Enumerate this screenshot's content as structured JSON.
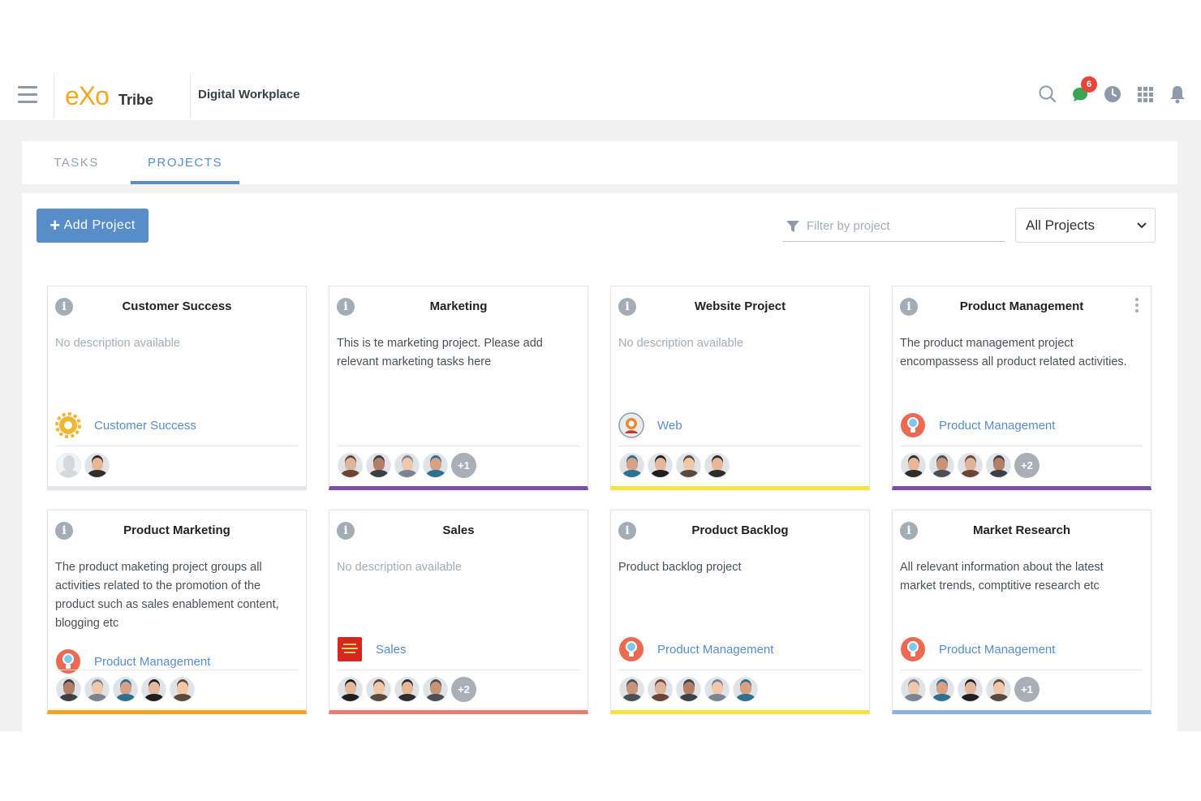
{
  "header": {
    "logo_text": "eXo",
    "brand_suffix": "Tribe",
    "workspace": "Digital Workplace",
    "chat_badge": "6"
  },
  "tabs": {
    "tasks": "TASKS",
    "projects": "PROJECTS",
    "active": "projects"
  },
  "toolbar": {
    "add_label": "Add Project",
    "filter_placeholder": "Filter by project",
    "select_value": "All Projects"
  },
  "colors": {
    "accent": "#578dc9",
    "logo": "#f4a81d",
    "badge": "#e9453a"
  },
  "projects": [
    {
      "title": "Customer Success",
      "description": "No description available",
      "space": "Customer Success",
      "space_icon": "gear-icon",
      "members_more": "",
      "color": "#e3e5e8"
    },
    {
      "title": "Marketing",
      "description": "This is te marketing project. Please add relevant marketing tasks here",
      "space": "",
      "space_icon": "",
      "members_more": "+1",
      "color": "#7e4fad"
    },
    {
      "title": "Website Project",
      "description": "No description available",
      "space": "Web",
      "space_icon": "web-space-icon",
      "members_more": "",
      "color": "#f6e33c"
    },
    {
      "title": "Product Management",
      "description": "The product management project encompassess all product related activities.",
      "space": "Product Management",
      "space_icon": "lightbulb-icon",
      "members_more": "+2",
      "color": "#7e4fad"
    },
    {
      "title": "Product Marketing",
      "description": "The product maketing project groups all activities related to the promotion of the product such as sales enablement content, blogging etc",
      "space": "Product Management",
      "space_icon": "lightbulb-icon",
      "members_more": "",
      "color": "#f2a41c"
    },
    {
      "title": "Sales",
      "description": "No description available",
      "space": "Sales",
      "space_icon": "sales-space-icon",
      "members_more": "+2",
      "color": "#ea7d73"
    },
    {
      "title": "Product Backlog",
      "description": "Product backlog project",
      "space": "Product Management",
      "space_icon": "lightbulb-icon",
      "members_more": "",
      "color": "#f6e33c"
    },
    {
      "title": "Market Research",
      "description": "All relevant information about the latest market trends, comptitive research etc",
      "space": "Product Management",
      "space_icon": "lightbulb-icon",
      "members_more": "+1",
      "color": "#8fb3e0"
    }
  ]
}
